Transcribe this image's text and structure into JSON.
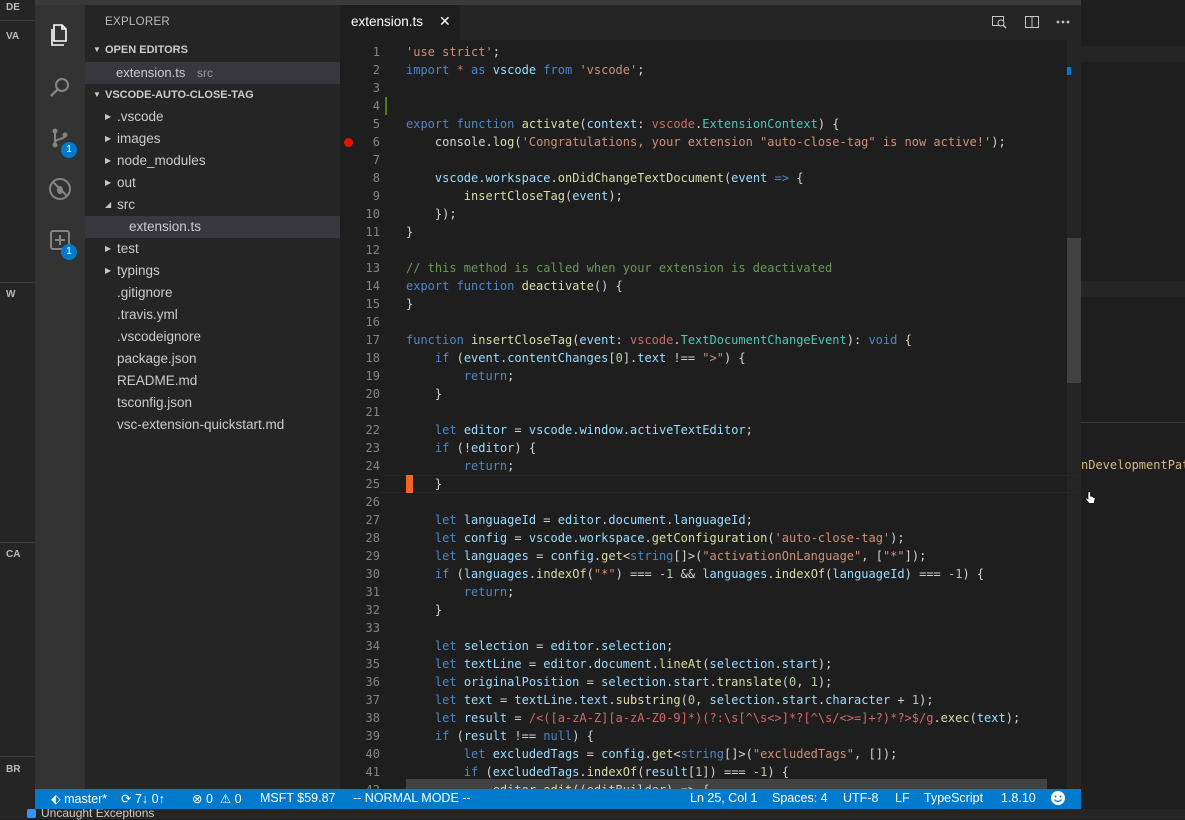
{
  "background_ui": {
    "left_labels": [
      "DE",
      "VA",
      "W",
      "CA",
      "BR"
    ],
    "right_snippet": "nDevelopmentPat",
    "bottom_text": "Uncaught Exceptions"
  },
  "activity_bar": {
    "git_badge": "1",
    "extensions_badge": "1"
  },
  "sidebar": {
    "title": "EXPLORER",
    "open_editors_label": "OPEN EDITORS",
    "open_editor": {
      "name": "extension.ts",
      "dir": "src"
    },
    "project_label": "VSCODE-AUTO-CLOSE-TAG",
    "tree": [
      {
        "label": ".vscode",
        "folder": true,
        "expanded": false,
        "depth": 0
      },
      {
        "label": "images",
        "folder": true,
        "expanded": false,
        "depth": 0
      },
      {
        "label": "node_modules",
        "folder": true,
        "expanded": false,
        "depth": 0
      },
      {
        "label": "out",
        "folder": true,
        "expanded": false,
        "depth": 0
      },
      {
        "label": "src",
        "folder": true,
        "expanded": true,
        "depth": 0
      },
      {
        "label": "extension.ts",
        "folder": false,
        "depth": 1,
        "selected": true
      },
      {
        "label": "test",
        "folder": true,
        "expanded": false,
        "depth": 0
      },
      {
        "label": "typings",
        "folder": true,
        "expanded": false,
        "depth": 0
      },
      {
        "label": ".gitignore",
        "folder": false,
        "depth": 0
      },
      {
        "label": ".travis.yml",
        "folder": false,
        "depth": 0
      },
      {
        "label": ".vscodeignore",
        "folder": false,
        "depth": 0
      },
      {
        "label": "package.json",
        "folder": false,
        "depth": 0
      },
      {
        "label": "README.md",
        "folder": false,
        "depth": 0
      },
      {
        "label": "tsconfig.json",
        "folder": false,
        "depth": 0
      },
      {
        "label": "vsc-extension-quickstart.md",
        "folder": false,
        "depth": 0
      }
    ]
  },
  "editor": {
    "tab_label": "extension.ts",
    "tab_close": "✕",
    "first_line_number": 1,
    "current_line": 25,
    "breakpoint_line": 6,
    "modified_line": 4,
    "lines": [
      [
        [
          "s",
          "'use strict'"
        ],
        [
          "o",
          ";"
        ]
      ],
      [
        [
          "k",
          "import "
        ],
        [
          "r",
          "*"
        ],
        [
          "k",
          " as "
        ],
        [
          "v",
          "vscode"
        ],
        [
          "k",
          " from "
        ],
        [
          "s",
          "'vscode'"
        ],
        [
          "o",
          ";"
        ]
      ],
      [],
      [],
      [
        [
          "k",
          "export function "
        ],
        [
          "f",
          "activate"
        ],
        [
          "o",
          "("
        ],
        [
          "v",
          "context"
        ],
        [
          "o",
          ": "
        ],
        [
          "r",
          "vscode"
        ],
        [
          "o",
          "."
        ],
        [
          "t",
          "ExtensionContext"
        ],
        [
          "o",
          ") {"
        ]
      ],
      [
        [
          "o",
          "    console."
        ],
        [
          "f",
          "log"
        ],
        [
          "o",
          "("
        ],
        [
          "s",
          "'Congratulations, your extension \"auto-close-tag\" is now active!'"
        ],
        [
          "o",
          ");"
        ]
      ],
      [],
      [
        [
          "o",
          "    "
        ],
        [
          "v",
          "vscode"
        ],
        [
          "o",
          "."
        ],
        [
          "v",
          "workspace"
        ],
        [
          "o",
          "."
        ],
        [
          "f",
          "onDidChangeTextDocument"
        ],
        [
          "o",
          "("
        ],
        [
          "v",
          "event"
        ],
        [
          "k",
          " => "
        ],
        [
          "o",
          "{"
        ]
      ],
      [
        [
          "o",
          "        "
        ],
        [
          "f",
          "insertCloseTag"
        ],
        [
          "o",
          "("
        ],
        [
          "v",
          "event"
        ],
        [
          "o",
          ");"
        ]
      ],
      [
        [
          "o",
          "    });"
        ]
      ],
      [
        [
          "o",
          "}"
        ]
      ],
      [],
      [
        [
          "c",
          "// this method is called when your extension is deactivated"
        ]
      ],
      [
        [
          "k",
          "export function "
        ],
        [
          "f",
          "deactivate"
        ],
        [
          "o",
          "() {"
        ]
      ],
      [
        [
          "o",
          "}"
        ]
      ],
      [],
      [
        [
          "k",
          "function "
        ],
        [
          "f",
          "insertCloseTag"
        ],
        [
          "o",
          "("
        ],
        [
          "v",
          "event"
        ],
        [
          "o",
          ": "
        ],
        [
          "r",
          "vscode"
        ],
        [
          "o",
          "."
        ],
        [
          "t",
          "TextDocumentChangeEvent"
        ],
        [
          "o",
          "): "
        ],
        [
          "k",
          "void"
        ],
        [
          "o",
          " {"
        ]
      ],
      [
        [
          "o",
          "    "
        ],
        [
          "k",
          "if "
        ],
        [
          "o",
          "("
        ],
        [
          "v",
          "event"
        ],
        [
          "o",
          "."
        ],
        [
          "v",
          "contentChanges"
        ],
        [
          "o",
          "["
        ],
        [
          "n",
          "0"
        ],
        [
          "o",
          "]."
        ],
        [
          "v",
          "text"
        ],
        [
          "o",
          " !== "
        ],
        [
          "s",
          "\">\""
        ],
        [
          "o",
          ") {"
        ]
      ],
      [
        [
          "o",
          "        "
        ],
        [
          "k",
          "return"
        ],
        [
          "o",
          ";"
        ]
      ],
      [
        [
          "o",
          "    }"
        ]
      ],
      [],
      [
        [
          "o",
          "    "
        ],
        [
          "k",
          "let "
        ],
        [
          "v",
          "editor"
        ],
        [
          "o",
          " = "
        ],
        [
          "v",
          "vscode"
        ],
        [
          "o",
          "."
        ],
        [
          "v",
          "window"
        ],
        [
          "o",
          "."
        ],
        [
          "v",
          "activeTextEditor"
        ],
        [
          "o",
          ";"
        ]
      ],
      [
        [
          "o",
          "    "
        ],
        [
          "k",
          "if "
        ],
        [
          "o",
          "(!"
        ],
        [
          "v",
          "editor"
        ],
        [
          "o",
          ") {"
        ]
      ],
      [
        [
          "o",
          "        "
        ],
        [
          "k",
          "return"
        ],
        [
          "o",
          ";"
        ]
      ],
      [
        [
          "o",
          "    }"
        ]
      ],
      [],
      [
        [
          "o",
          "    "
        ],
        [
          "k",
          "let "
        ],
        [
          "v",
          "languageId"
        ],
        [
          "o",
          " = "
        ],
        [
          "v",
          "editor"
        ],
        [
          "o",
          "."
        ],
        [
          "v",
          "document"
        ],
        [
          "o",
          "."
        ],
        [
          "v",
          "languageId"
        ],
        [
          "o",
          ";"
        ]
      ],
      [
        [
          "o",
          "    "
        ],
        [
          "k",
          "let "
        ],
        [
          "v",
          "config"
        ],
        [
          "o",
          " = "
        ],
        [
          "v",
          "vscode"
        ],
        [
          "o",
          "."
        ],
        [
          "v",
          "workspace"
        ],
        [
          "o",
          "."
        ],
        [
          "f",
          "getConfiguration"
        ],
        [
          "o",
          "("
        ],
        [
          "s",
          "'auto-close-tag'"
        ],
        [
          "o",
          ");"
        ]
      ],
      [
        [
          "o",
          "    "
        ],
        [
          "k",
          "let "
        ],
        [
          "v",
          "languages"
        ],
        [
          "o",
          " = "
        ],
        [
          "v",
          "config"
        ],
        [
          "o",
          "."
        ],
        [
          "f",
          "get"
        ],
        [
          "o",
          "<"
        ],
        [
          "k",
          "string"
        ],
        [
          "o",
          "[]>("
        ],
        [
          "s",
          "\"activationOnLanguage\""
        ],
        [
          "o",
          ", ["
        ],
        [
          "s",
          "\"*\""
        ],
        [
          "o",
          "]);"
        ]
      ],
      [
        [
          "o",
          "    "
        ],
        [
          "k",
          "if "
        ],
        [
          "o",
          "("
        ],
        [
          "v",
          "languages"
        ],
        [
          "o",
          "."
        ],
        [
          "f",
          "indexOf"
        ],
        [
          "o",
          "("
        ],
        [
          "s",
          "\"*\""
        ],
        [
          "o",
          ") === "
        ],
        [
          "n",
          "-1"
        ],
        [
          "o",
          " && "
        ],
        [
          "v",
          "languages"
        ],
        [
          "o",
          "."
        ],
        [
          "f",
          "indexOf"
        ],
        [
          "o",
          "("
        ],
        [
          "v",
          "languageId"
        ],
        [
          "o",
          ") === "
        ],
        [
          "n",
          "-1"
        ],
        [
          "o",
          ") {"
        ]
      ],
      [
        [
          "o",
          "        "
        ],
        [
          "k",
          "return"
        ],
        [
          "o",
          ";"
        ]
      ],
      [
        [
          "o",
          "    }"
        ]
      ],
      [],
      [
        [
          "o",
          "    "
        ],
        [
          "k",
          "let "
        ],
        [
          "v",
          "selection"
        ],
        [
          "o",
          " = "
        ],
        [
          "v",
          "editor"
        ],
        [
          "o",
          "."
        ],
        [
          "v",
          "selection"
        ],
        [
          "o",
          ";"
        ]
      ],
      [
        [
          "o",
          "    "
        ],
        [
          "k",
          "let "
        ],
        [
          "v",
          "textLine"
        ],
        [
          "o",
          " = "
        ],
        [
          "v",
          "editor"
        ],
        [
          "o",
          "."
        ],
        [
          "v",
          "document"
        ],
        [
          "o",
          "."
        ],
        [
          "f",
          "lineAt"
        ],
        [
          "o",
          "("
        ],
        [
          "v",
          "selection"
        ],
        [
          "o",
          "."
        ],
        [
          "v",
          "start"
        ],
        [
          "o",
          ");"
        ]
      ],
      [
        [
          "o",
          "    "
        ],
        [
          "k",
          "let "
        ],
        [
          "v",
          "originalPosition"
        ],
        [
          "o",
          " = "
        ],
        [
          "v",
          "selection"
        ],
        [
          "o",
          "."
        ],
        [
          "v",
          "start"
        ],
        [
          "o",
          "."
        ],
        [
          "f",
          "translate"
        ],
        [
          "o",
          "("
        ],
        [
          "n",
          "0"
        ],
        [
          "o",
          ", "
        ],
        [
          "n",
          "1"
        ],
        [
          "o",
          ");"
        ]
      ],
      [
        [
          "o",
          "    "
        ],
        [
          "k",
          "let "
        ],
        [
          "v",
          "text"
        ],
        [
          "o",
          " = "
        ],
        [
          "v",
          "textLine"
        ],
        [
          "o",
          "."
        ],
        [
          "v",
          "text"
        ],
        [
          "o",
          "."
        ],
        [
          "f",
          "substring"
        ],
        [
          "o",
          "("
        ],
        [
          "n",
          "0"
        ],
        [
          "o",
          ", "
        ],
        [
          "v",
          "selection"
        ],
        [
          "o",
          "."
        ],
        [
          "v",
          "start"
        ],
        [
          "o",
          "."
        ],
        [
          "v",
          "character"
        ],
        [
          "o",
          " + "
        ],
        [
          "n",
          "1"
        ],
        [
          "o",
          ");"
        ]
      ],
      [
        [
          "o",
          "    "
        ],
        [
          "k",
          "let "
        ],
        [
          "v",
          "result"
        ],
        [
          "o",
          " = "
        ],
        [
          "r",
          "/<([a-zA-Z][a-zA-Z0-9]*)(?:\\s[^\\s<>]*?[^\\s/<>=]+?)*?>$/g"
        ],
        [
          "o",
          "."
        ],
        [
          "f",
          "exec"
        ],
        [
          "o",
          "("
        ],
        [
          "v",
          "text"
        ],
        [
          "o",
          ");"
        ]
      ],
      [
        [
          "o",
          "    "
        ],
        [
          "k",
          "if "
        ],
        [
          "o",
          "("
        ],
        [
          "v",
          "result"
        ],
        [
          "o",
          " !== "
        ],
        [
          "k",
          "null"
        ],
        [
          "o",
          ") {"
        ]
      ],
      [
        [
          "o",
          "        "
        ],
        [
          "k",
          "let "
        ],
        [
          "v",
          "excludedTags"
        ],
        [
          "o",
          " = "
        ],
        [
          "v",
          "config"
        ],
        [
          "o",
          "."
        ],
        [
          "f",
          "get"
        ],
        [
          "o",
          "<"
        ],
        [
          "k",
          "string"
        ],
        [
          "o",
          "[]>("
        ],
        [
          "s",
          "\"excludedTags\""
        ],
        [
          "o",
          ", []);"
        ]
      ],
      [
        [
          "o",
          "        "
        ],
        [
          "k",
          "if "
        ],
        [
          "o",
          "("
        ],
        [
          "v",
          "excludedTags"
        ],
        [
          "o",
          "."
        ],
        [
          "f",
          "indexOf"
        ],
        [
          "o",
          "("
        ],
        [
          "v",
          "result"
        ],
        [
          "o",
          "["
        ],
        [
          "n",
          "1"
        ],
        [
          "o",
          "]) === "
        ],
        [
          "n",
          "-1"
        ],
        [
          "o",
          ") {"
        ]
      ],
      [
        [
          "o",
          "            "
        ],
        [
          "v",
          "editor"
        ],
        [
          "o",
          "."
        ],
        [
          "f",
          "edit"
        ],
        [
          "o",
          "(("
        ],
        [
          "v",
          "editBuilder"
        ],
        [
          "o",
          ") => {"
        ]
      ]
    ]
  },
  "status_bar": {
    "branch": "master*",
    "sync": "7↓ 0↑",
    "errors": "0",
    "warnings": "0",
    "stock": "MSFT $59.87",
    "vim_mode": "-- NORMAL MODE --",
    "position": "Ln 25, Col 1",
    "indent": "Spaces: 4",
    "encoding": "UTF-8",
    "eol": "LF",
    "language": "TypeScript",
    "version": "1.8.10"
  },
  "colors": {
    "accent": "#007acc",
    "status_bg": "#007acc",
    "editor_bg": "#1e1e1e",
    "sidebar_bg": "#252526",
    "activity_bg": "#333333",
    "breakpoint": "#e51400",
    "cursor": "#f26522"
  }
}
